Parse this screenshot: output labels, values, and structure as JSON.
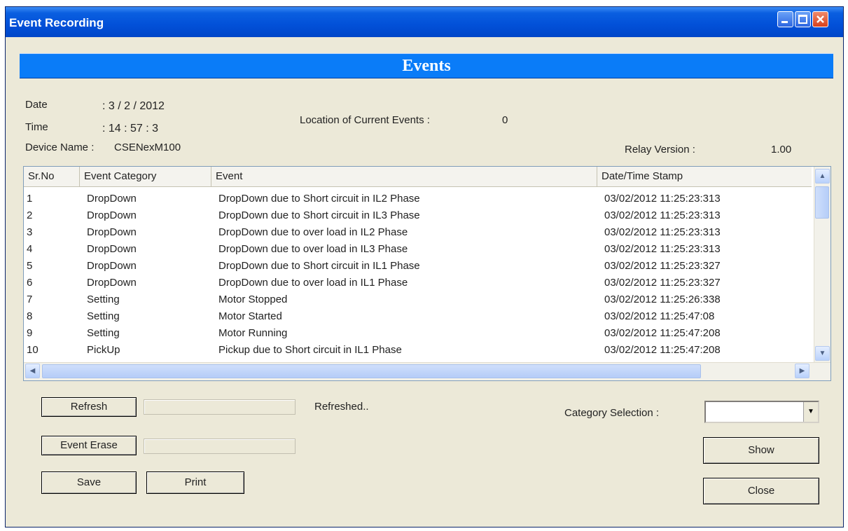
{
  "window": {
    "title": "Event Recording",
    "minimize_icon": "minimize-icon",
    "maximize_icon": "maximize-icon",
    "close_icon": "close-icon"
  },
  "banner": {
    "title": "Events"
  },
  "info": {
    "date_label": "Date",
    "date_value": ": 3  / 2  / 2012",
    "time_label": "Time",
    "time_value": ": 14  :  57  :  3",
    "device_label": "Device Name :",
    "device_value": "CSENexM100",
    "location_label": "Location of Current Events :",
    "location_value": "0",
    "relay_label": "Relay  Version :",
    "relay_value": "1.00"
  },
  "table": {
    "columns": [
      "Sr.No",
      "Event Category",
      "Event",
      "Date/Time Stamp"
    ],
    "rows": [
      {
        "sr": "1",
        "category": "DropDown",
        "event": "DropDown due to Short circuit in IL2  Phase",
        "stamp": "03/02/2012  11:25:23:313"
      },
      {
        "sr": "2",
        "category": "DropDown",
        "event": "DropDown due to Short circuit in IL3  Phase",
        "stamp": "03/02/2012  11:25:23:313"
      },
      {
        "sr": "3",
        "category": "DropDown",
        "event": "DropDown due to over load in IL2  Phase",
        "stamp": "03/02/2012  11:25:23:313"
      },
      {
        "sr": "4",
        "category": "DropDown",
        "event": "DropDown due to over load in IL3  Phase",
        "stamp": "03/02/2012  11:25:23:313"
      },
      {
        "sr": "5",
        "category": "DropDown",
        "event": "DropDown due to Short circuit in IL1  Phase",
        "stamp": "03/02/2012  11:25:23:327"
      },
      {
        "sr": "6",
        "category": "DropDown",
        "event": "DropDown due to over load in IL1  Phase",
        "stamp": "03/02/2012  11:25:23:327"
      },
      {
        "sr": "7",
        "category": "Setting",
        "event": "Motor Stopped",
        "stamp": "03/02/2012  11:25:26:338"
      },
      {
        "sr": "8",
        "category": "Setting",
        "event": "Motor Started",
        "stamp": "03/02/2012  11:25:47:08"
      },
      {
        "sr": "9",
        "category": "Setting",
        "event": "Motor Running",
        "stamp": "03/02/2012  11:25:47:208"
      },
      {
        "sr": "10",
        "category": "PickUp",
        "event": "Pickup due to Short circuit in IL1  Phase",
        "stamp": "03/02/2012  11:25:47:208"
      }
    ]
  },
  "controls": {
    "refresh_label": "Refresh",
    "refresh_status": "Refreshed..",
    "erase_label": "Event Erase",
    "save_label": "Save",
    "print_label": "Print",
    "category_label": "Category Selection :",
    "category_value": "",
    "show_label": "Show",
    "close_label": "Close"
  },
  "colors": {
    "titlebar": "#0250d8",
    "banner": "#0a7cf8",
    "window_bg": "#ece9d8"
  }
}
